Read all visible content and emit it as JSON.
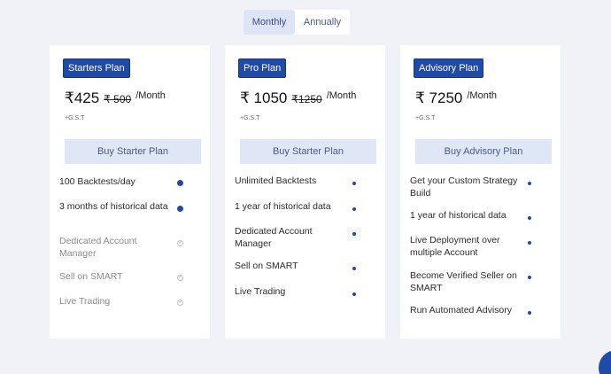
{
  "billing_toggle": {
    "monthly": "Monthly",
    "annually": "Annually",
    "selected": "Monthly"
  },
  "plans": [
    {
      "badge": "Starters Plan",
      "price": "₹425",
      "old_price": "₹ 500",
      "per": "/Month",
      "tax": "+G.S.T",
      "button": "Buy Starter Plan",
      "features": [
        {
          "text": "100 Backtests/day",
          "included": true
        },
        {
          "text": "3 months of historical data",
          "included": true
        },
        {
          "text": "Dedicated Account Manager",
          "included": false
        },
        {
          "text": "Sell on SMART",
          "included": false
        },
        {
          "text": "Live Trading",
          "included": false
        }
      ]
    },
    {
      "badge": "Pro Plan",
      "price": "₹ 1050",
      "old_price": "₹1250",
      "per": "/Month",
      "tax": "+G.S.T",
      "button": "Buy Starter Plan",
      "features": [
        {
          "text": "Unlimited Backtests",
          "included": true
        },
        {
          "text": "1 year of historical data",
          "included": true
        },
        {
          "text": "Dedicated Account Manager",
          "included": true
        },
        {
          "text": "Sell on SMART",
          "included": true
        },
        {
          "text": "Live Trading",
          "included": true
        }
      ]
    },
    {
      "badge": "Advisory Plan",
      "price": "₹ 7250",
      "old_price": "",
      "per": "/Month",
      "tax": "+G.S.T",
      "button": "Buy Advisory Plan",
      "features": [
        {
          "text": "Get your Custom Strategy Build",
          "included": true
        },
        {
          "text": "1 year of historical data",
          "included": true
        },
        {
          "text": "Live Deployment over multiple Account",
          "included": true
        },
        {
          "text": "Become Verified Seller on SMART",
          "included": true
        },
        {
          "text": "Run Automated Advisory",
          "included": true
        }
      ]
    }
  ],
  "colors": {
    "accent": "#1f4aa8",
    "button_bg": "#dfe6f5",
    "page_bg": "#f1f2f7"
  }
}
